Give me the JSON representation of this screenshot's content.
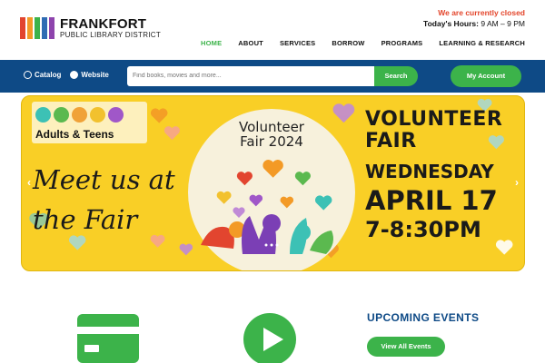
{
  "header": {
    "logo_line1": "FRANKFORT",
    "logo_line2": "PUBLIC LIBRARY DISTRICT",
    "logo_colors": [
      "#e2452f",
      "#f39a26",
      "#3cb34a",
      "#2e6bb3",
      "#8e44ad"
    ],
    "status_text": "We are currently closed",
    "hours_label": "Today's Hours:",
    "hours_value": "9 AM – 9 PM",
    "nav": [
      {
        "label": "HOME",
        "active": true
      },
      {
        "label": "ABOUT",
        "active": false
      },
      {
        "label": "SERVICES",
        "active": false
      },
      {
        "label": "BORROW",
        "active": false
      },
      {
        "label": "PROGRAMS",
        "active": false
      },
      {
        "label": "LEARNING & RESEARCH",
        "active": false
      }
    ]
  },
  "searchbar": {
    "radio_catalog": "Catalog",
    "radio_website": "Website",
    "selected": "Website",
    "placeholder": "Find books, movies and more...",
    "search_label": "Search",
    "account_label": "My Account"
  },
  "banner": {
    "audience_label": "Adults & Teens",
    "audience_dots": [
      "#3cc1b5",
      "#5bb94f",
      "#f0a238",
      "#f2c12e",
      "#a057c8"
    ],
    "meet_text": "Meet us at the Fair",
    "circle_title_1": "Volunteer",
    "circle_title_2": "Fair 2024",
    "heading_1": "VOLUNTEER",
    "heading_2": "FAIR",
    "day": "WEDNESDAY",
    "date": "APRIL 17",
    "time": "7-8:30PM",
    "prev_icon": "chevron-left-icon",
    "next_icon": "chevron-right-icon"
  },
  "bottom": {
    "card_icon": "credit-card-icon",
    "play_icon": "play-icon",
    "events_title": "UPCOMING EVENTS",
    "events_button": "View All Events"
  },
  "colors": {
    "brand_blue": "#0e4a86",
    "accent_green": "#3cb34a",
    "banner_yellow": "#f9cf26",
    "closed_red": "#e3452b"
  }
}
